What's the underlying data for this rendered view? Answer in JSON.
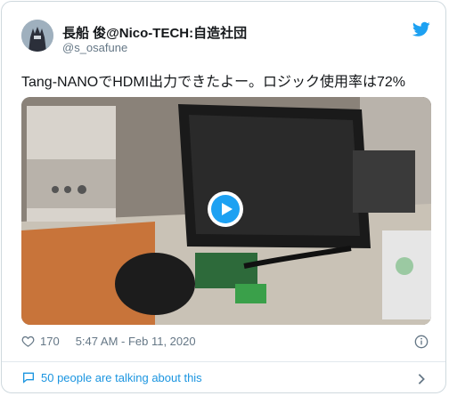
{
  "author": {
    "display_name": "長船 俊@Nico-TECH:自造社団",
    "handle": "@s_osafune"
  },
  "tweet": {
    "text": "Tang-NANOでHDMI出力できたよー。ロジック使用率は72%"
  },
  "media": {
    "type": "video",
    "play_button": "play-icon"
  },
  "stats": {
    "likes": "170",
    "timestamp": "5:47 AM - Feb 11, 2020"
  },
  "footer": {
    "conversation": "50 people are talking about this"
  },
  "colors": {
    "accent": "#1da1f2",
    "link": "#1b95e0",
    "muted": "#657786",
    "border": "#cfd9de"
  }
}
